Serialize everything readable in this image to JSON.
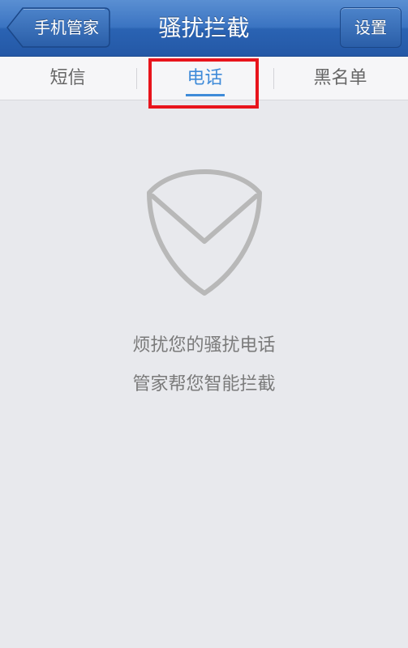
{
  "navbar": {
    "back_label": "手机管家",
    "title": "骚扰拦截",
    "settings_label": "设置"
  },
  "tabs": [
    {
      "label": "短信",
      "active": false
    },
    {
      "label": "电话",
      "active": true
    },
    {
      "label": "黑名单",
      "active": false
    }
  ],
  "empty_state": {
    "icon": "shield-icon",
    "line1": "烦扰您的骚扰电话",
    "line2": "管家帮您智能拦截"
  },
  "colors": {
    "navbar_blue": "#2a63b3",
    "active_tab": "#3f8bd9",
    "highlight_red": "#e8141c",
    "background": "#e8e9ed"
  }
}
